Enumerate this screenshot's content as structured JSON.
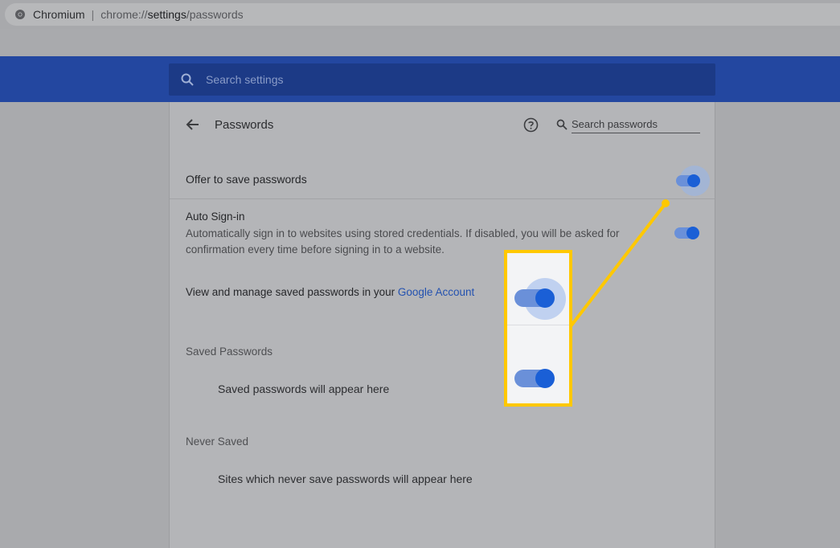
{
  "browser": {
    "app_name": "Chromium",
    "separator": "|",
    "url_scheme": "chrome://",
    "url_host": "settings",
    "url_path": "/passwords"
  },
  "settings_search": {
    "placeholder": "Search settings"
  },
  "page": {
    "title": "Passwords",
    "search_passwords_placeholder": "Search passwords"
  },
  "offer_to_save": {
    "label": "Offer to save passwords",
    "enabled": true
  },
  "auto_signin": {
    "label": "Auto Sign-in",
    "description": "Automatically sign in to websites using stored credentials. If disabled, you will be asked for confirmation every time before signing in to a website.",
    "enabled": true
  },
  "manage": {
    "prefix": "View and manage saved passwords in your ",
    "link": "Google Account"
  },
  "saved_passwords": {
    "header": "Saved Passwords",
    "empty": "Saved passwords will appear here"
  },
  "never_saved": {
    "header": "Never Saved",
    "empty": "Sites which never save passwords will appear here"
  },
  "callout": {
    "highlight_color": "#ffc800",
    "toggles_enabled": [
      true,
      true
    ]
  },
  "colors": {
    "header_blue": "#2347a0",
    "toggle_knob": "#1a5fd6",
    "toggle_track": "#6a90d9",
    "link": "#2452b0"
  }
}
